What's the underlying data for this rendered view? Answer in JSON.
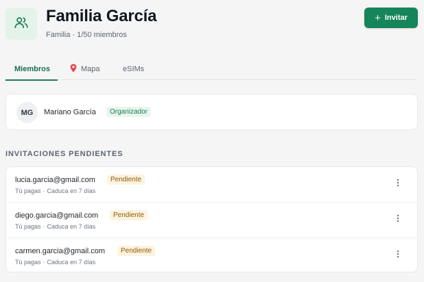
{
  "header": {
    "title": "Familia García",
    "group_type": "Familia",
    "separator": "·",
    "member_count": "1/50 miembros",
    "icon": "users-icon",
    "invite_label": "Invitar",
    "invite_icon": "plus-icon"
  },
  "tabs": [
    {
      "label": "Miembros",
      "active": true
    },
    {
      "label": "Mapa",
      "icon": "map-pin-icon",
      "active": false
    },
    {
      "label": "eSIMs",
      "active": false
    }
  ],
  "members": [
    {
      "initials": "MG",
      "name": "Mariano García",
      "role": "Organizador"
    }
  ],
  "pending": {
    "title": "INVITACIONES PENDIENTES",
    "items": [
      {
        "email": "lucia.garcia@gmail.com",
        "status": "Pendiente",
        "payer": "Tú pagas",
        "separator": "·",
        "expiry": "Caduca en 7 días"
      },
      {
        "email": "diego.garcia@gmail.com",
        "status": "Pendiente",
        "payer": "Tú pagas",
        "separator": "·",
        "expiry": "Caduca en 7 días"
      },
      {
        "email": "carmen.garcia@gmail.com",
        "status": "Pendiente",
        "payer": "Tú pagas",
        "separator": "·",
        "expiry": "Caduca en 7 días"
      }
    ]
  },
  "colors": {
    "accent": "#16855a",
    "background": "#f5f5f6",
    "pending_badge_bg": "#fdf3df",
    "organizer_badge_bg": "#e8f6ee"
  }
}
